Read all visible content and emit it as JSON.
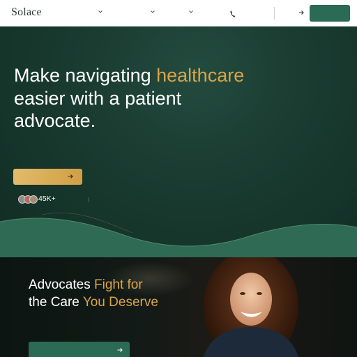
{
  "nav": {
    "logo": "Solace",
    "icons": [
      "chevron-down-icon",
      "chevron-down-icon",
      "chevron-down-icon",
      "phone-icon",
      "arrow-right-icon"
    ],
    "cta_color": "#2b6a54"
  },
  "hero": {
    "headline_part1": "Make navigating ",
    "headline_highlight": "healthcare",
    "headline_part2": " easier with a patient advocate.",
    "stat_value": "45K+",
    "button_color": "#d9a54a",
    "accent_color": "#d9a54a"
  },
  "section2": {
    "heading_1": "Advocates ",
    "heading_2": "Fight for",
    "heading_3": "the Care ",
    "heading_4": "You Deserve",
    "button_color": "#2b6a54"
  }
}
